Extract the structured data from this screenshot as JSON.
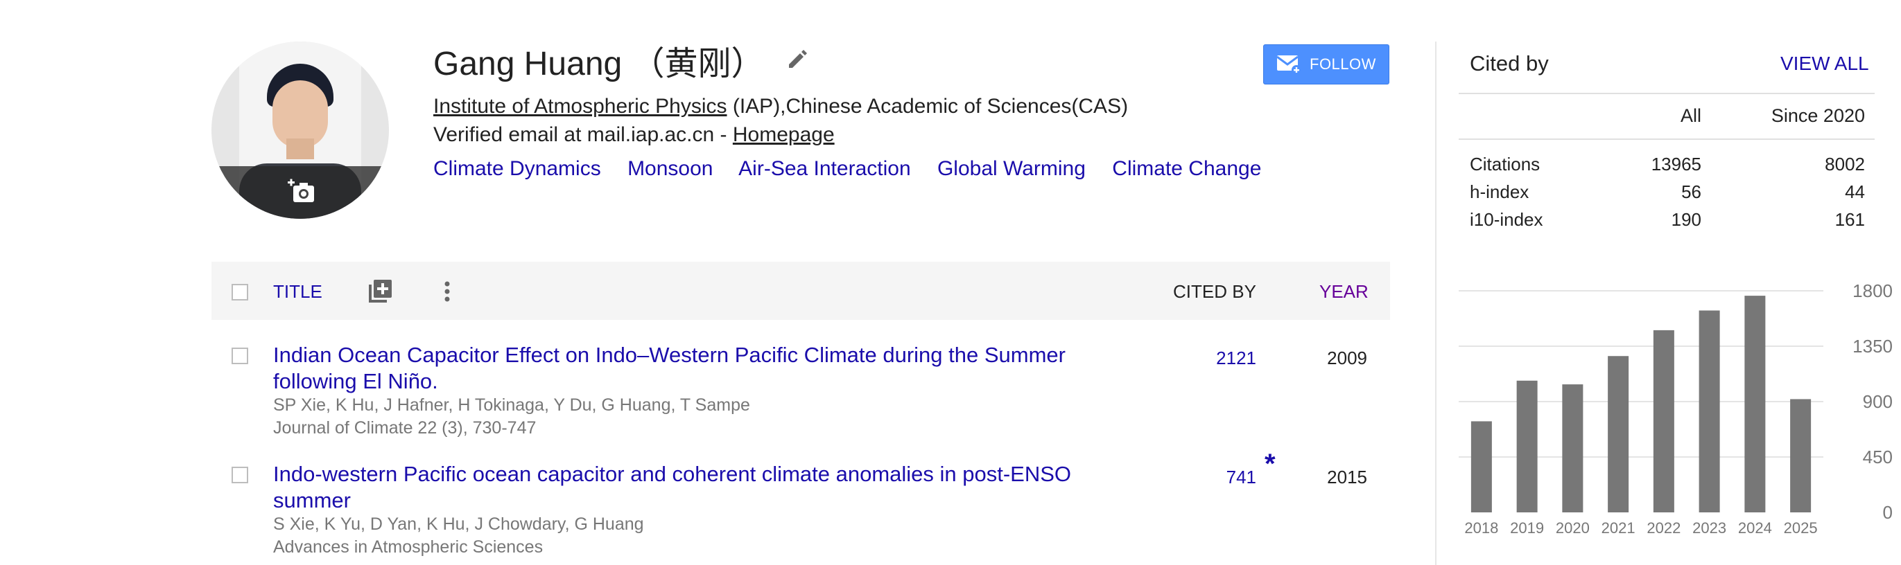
{
  "profile": {
    "name": "Gang Huang （黄刚）",
    "affiliation_link": "Institute of Atmospheric Physics",
    "affiliation_rest": " (IAP),Chinese Academic of Sciences(CAS)",
    "email_text": "Verified email at mail.iap.ac.cn - ",
    "homepage_label": "Homepage",
    "interests": [
      "Climate Dynamics",
      "Monsoon",
      "Air-Sea Interaction",
      "Global Warming",
      "Climate Change"
    ],
    "follow_label": "FOLLOW"
  },
  "table": {
    "col_title": "TITLE",
    "col_cited": "CITED BY",
    "col_year": "YEAR",
    "rows": [
      {
        "title": "Indian Ocean Capacitor Effect on Indo–Western Pacific Climate during the Summer following El Niño.",
        "authors": "SP Xie, K Hu, J Hafner, H Tokinaga, Y Du, G Huang, T Sampe",
        "venue": "Journal of Climate 22 (3), 730-747",
        "cited": "2121",
        "star": "",
        "year": "2009"
      },
      {
        "title": "Indo-western Pacific ocean capacitor and coherent climate anomalies in post-ENSO summer",
        "authors": "S Xie, K Yu, D Yan, K Hu, J Chowdary, G Huang",
        "venue": "Advances in Atmospheric Sciences",
        "cited": "741",
        "star": "*",
        "year": "2015"
      }
    ]
  },
  "cited_by": {
    "title": "Cited by",
    "view_all": "VIEW ALL",
    "col_all": "All",
    "col_since": "Since 2020",
    "rows": [
      {
        "label": "Citations",
        "all": "13965",
        "since": "8002"
      },
      {
        "label": "h-index",
        "all": "56",
        "since": "44"
      },
      {
        "label": "i10-index",
        "all": "190",
        "since": "161"
      }
    ]
  },
  "chart_data": {
    "type": "bar",
    "categories": [
      "2018",
      "2019",
      "2020",
      "2021",
      "2022",
      "2023",
      "2024",
      "2025"
    ],
    "values": [
      740,
      1070,
      1040,
      1270,
      1480,
      1640,
      1760,
      920
    ],
    "yticks": [
      "1800",
      "1350",
      "900",
      "450",
      "0"
    ],
    "ylim": [
      0,
      1800
    ],
    "grid": true,
    "bar_color": "#777777"
  },
  "colors": {
    "link": "#1a0dab",
    "follow_button": "#4d90fe",
    "year_header": "#660099"
  }
}
